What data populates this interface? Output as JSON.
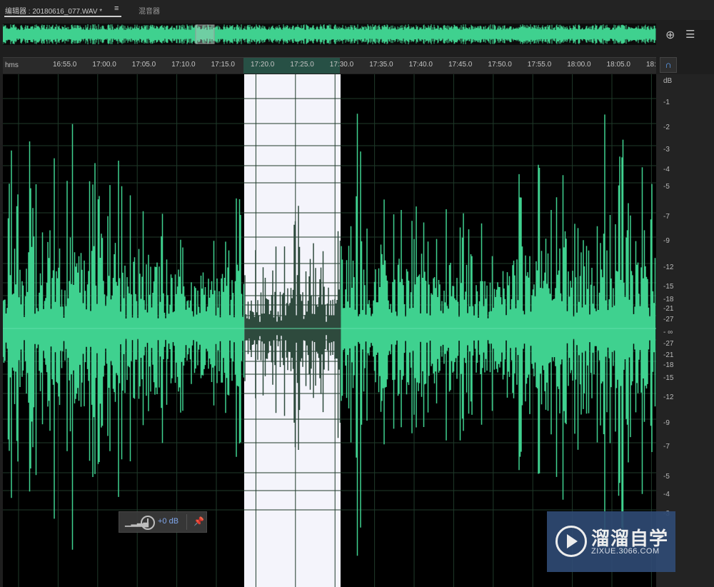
{
  "tabs": {
    "editor_label": "编辑器 : 20180616_077.WAV *",
    "menu_glyph": "≡",
    "mixer_label": "混音器"
  },
  "ruler": {
    "unit_label": "hms",
    "ticks": [
      "16:55.0",
      "17:00.0",
      "17:05.0",
      "17:10.0",
      "17:15.0",
      "17:20.0",
      "17:25.0",
      "17:30.0",
      "17:35.0",
      "17:40.0",
      "17:45.0",
      "17:50.0",
      "17:55.0",
      "18:00.0",
      "18:05.0",
      "18:"
    ]
  },
  "db_scale": {
    "labels": [
      "dB",
      "-1",
      "-2",
      "-3",
      "-4",
      "-5",
      "-7",
      "-9",
      "-12",
      "-15",
      "-18",
      "-21",
      "-27",
      "- ∞",
      "-27",
      "-21",
      "-18",
      "-15",
      "-12",
      "-9",
      "-7",
      "-5",
      "-4",
      "-3"
    ]
  },
  "hud": {
    "bars_glyph": "▁▂▃▄",
    "gain_value": "+0 dB",
    "pin_glyph": "📌"
  },
  "icons": {
    "zoom": "zoom-icon",
    "list": "list-icon",
    "snap": "snap-icon"
  },
  "watermark": {
    "title": "溜溜自学",
    "url": "ZIXUE.3066.COM"
  },
  "colors": {
    "waveform": "#3fd18f",
    "selected_wave": "#2e4a3d",
    "selection_bg": "#f4f4fb",
    "background": "#000000",
    "watermark_bg": "#2f4a73"
  }
}
